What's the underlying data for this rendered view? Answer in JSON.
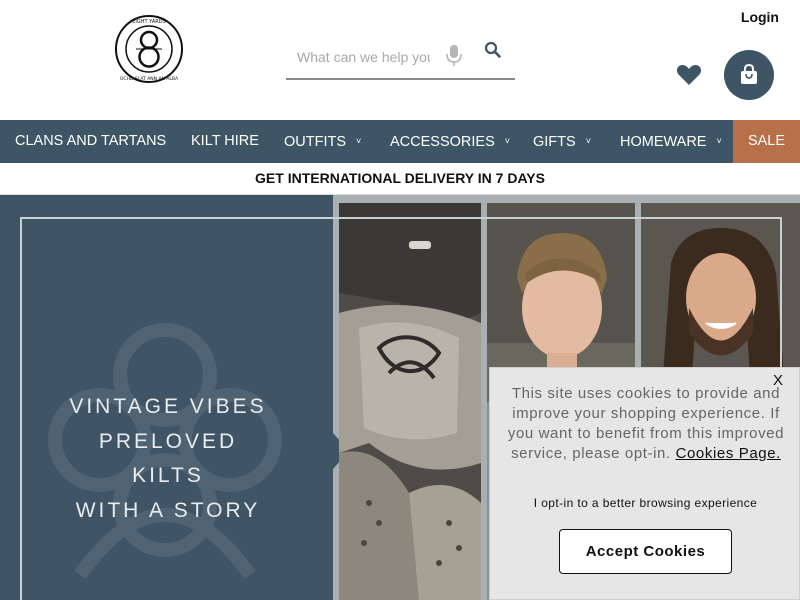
{
  "header": {
    "login_label": "Login",
    "search_placeholder": "What can we help you find?",
    "icons": {
      "logo": "eight-yards-logo",
      "mic": "mic-icon",
      "search": "search-icon",
      "wishlist": "heart-icon",
      "bag": "shopping-bag-icon"
    },
    "logo_text": "EIGHT YARDS · OCHD SLAT ANN AN ALBA"
  },
  "nav": {
    "items": [
      {
        "label": "Clans and Tartans",
        "has_dropdown": false
      },
      {
        "label": "Kilt Hire",
        "has_dropdown": false
      },
      {
        "label": "Outfits",
        "has_dropdown": true
      },
      {
        "label": "Accessories",
        "has_dropdown": true
      },
      {
        "label": "Gifts",
        "has_dropdown": true
      },
      {
        "label": "Homeware",
        "has_dropdown": true
      }
    ],
    "sale_label": "Sale",
    "chevron": "˅"
  },
  "promo": {
    "text": "Get International Delivery in 7 Days"
  },
  "hero": {
    "lines": [
      "VINTAGE VIBES",
      "PRELOVED",
      "KILTS",
      "WITH A STORY"
    ]
  },
  "cookie": {
    "close_label": "X",
    "message": "This site uses cookies to provide and improve your shopping experience. If you want to benefit from this improved service, please opt-in.",
    "link_label": "Cookies Page.",
    "optin_text": "I opt-in to a better browsing experience",
    "accept_label": "Accept Cookies"
  },
  "colors": {
    "nav_bg": "#3d5565",
    "sale_bg": "#b8704b",
    "hero_panel": "#3f5464",
    "cookie_bg": "#e6e6e6"
  }
}
